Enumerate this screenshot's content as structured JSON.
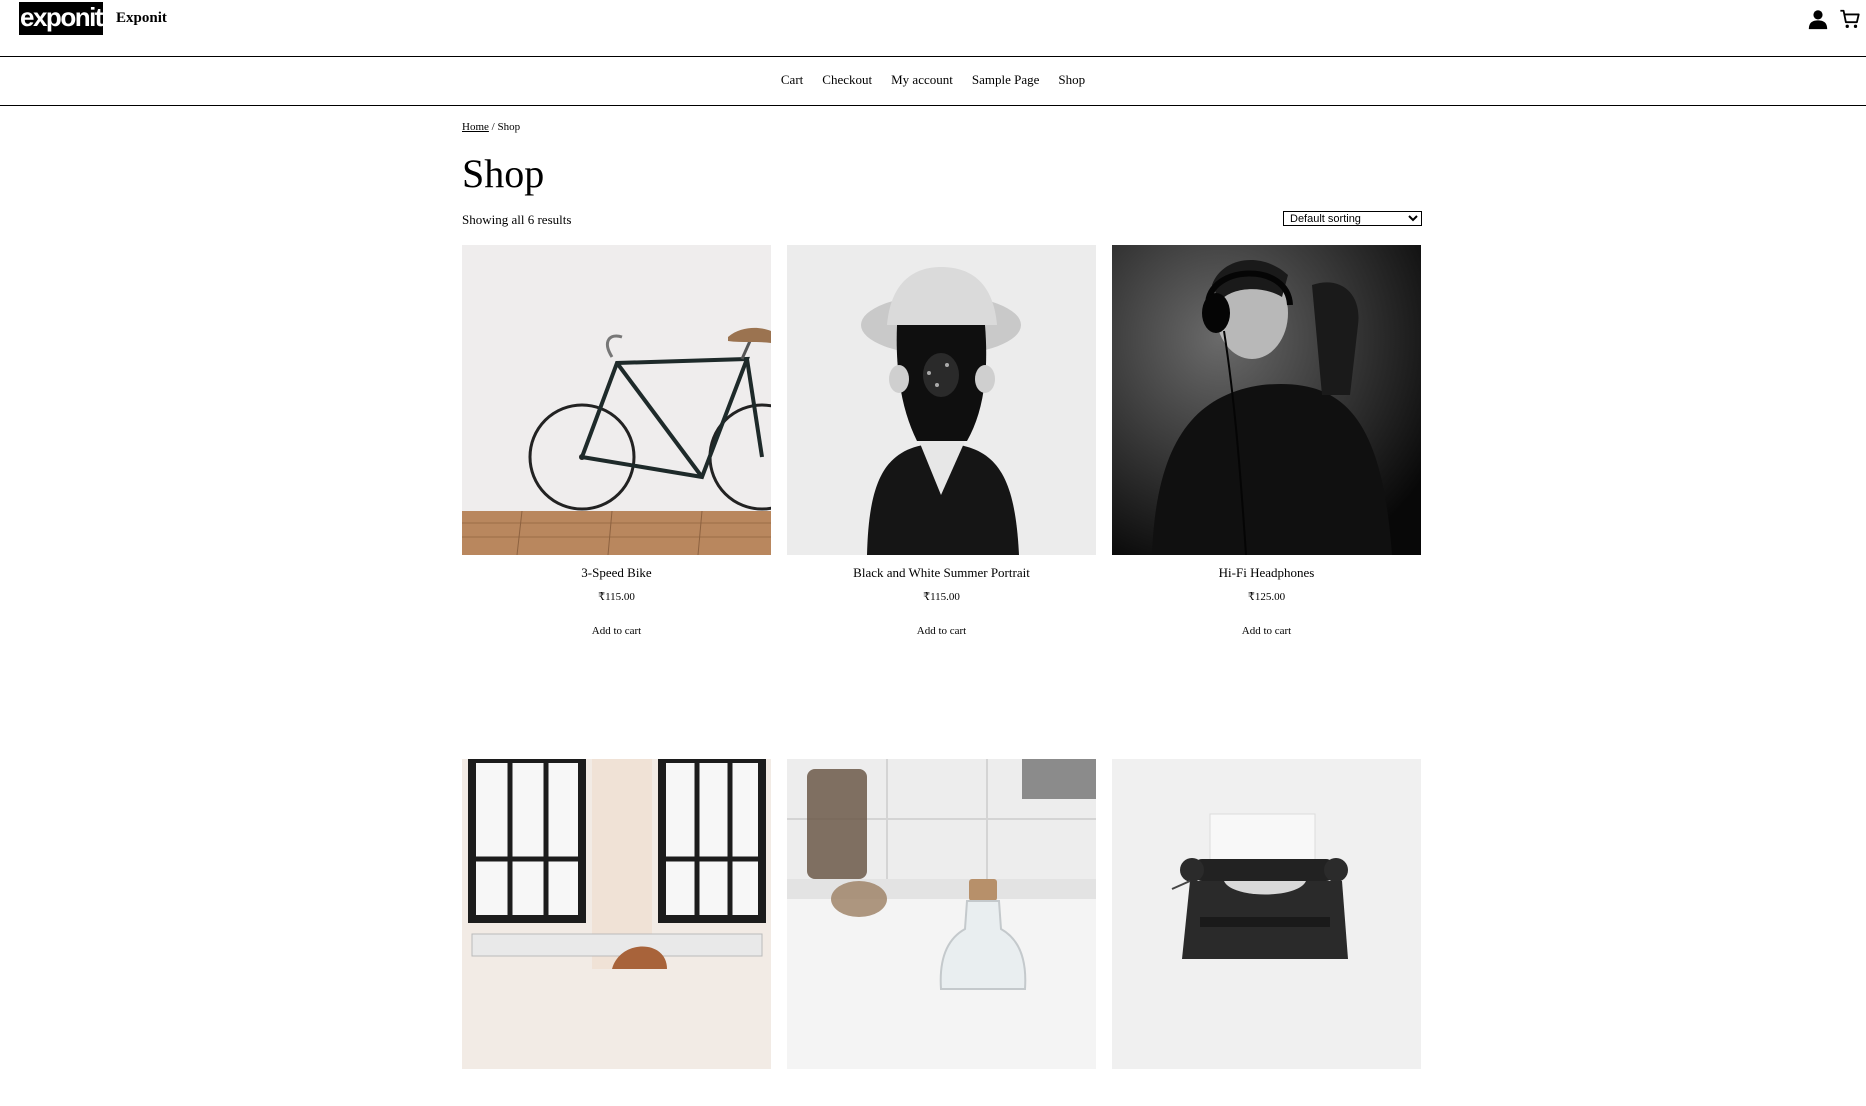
{
  "site": {
    "logo_text": "exponit",
    "title": "Exponit"
  },
  "header": {
    "account_icon": "account-icon",
    "cart_icon": "cart-icon"
  },
  "nav": {
    "items": [
      {
        "label": "Cart"
      },
      {
        "label": "Checkout"
      },
      {
        "label": "My account"
      },
      {
        "label": "Sample Page"
      },
      {
        "label": "Shop"
      }
    ]
  },
  "breadcrumb": {
    "home": "Home",
    "separator": " / ",
    "current": "Shop"
  },
  "page": {
    "title": "Shop",
    "result_count": "Showing all 6 results",
    "sorting": {
      "selected": "Default sorting"
    }
  },
  "products": [
    {
      "name": "3-Speed Bike",
      "price": "₹115.00",
      "button": "Add to cart",
      "image": "bicycle-photo"
    },
    {
      "name": "Black and White Summer Portrait",
      "price": "₹115.00",
      "button": "Add to cart",
      "image": "woman-in-hat-photo"
    },
    {
      "name": "Hi-Fi Headphones",
      "price": "₹125.00",
      "button": "Add to cart",
      "image": "man-with-headphones-photo"
    },
    {
      "name": "",
      "price": "",
      "button": "",
      "image": "chair-by-window-photo"
    },
    {
      "name": "",
      "price": "",
      "button": "",
      "image": "glass-bottle-photo"
    },
    {
      "name": "",
      "price": "",
      "button": "",
      "image": "typewriter-photo"
    }
  ]
}
